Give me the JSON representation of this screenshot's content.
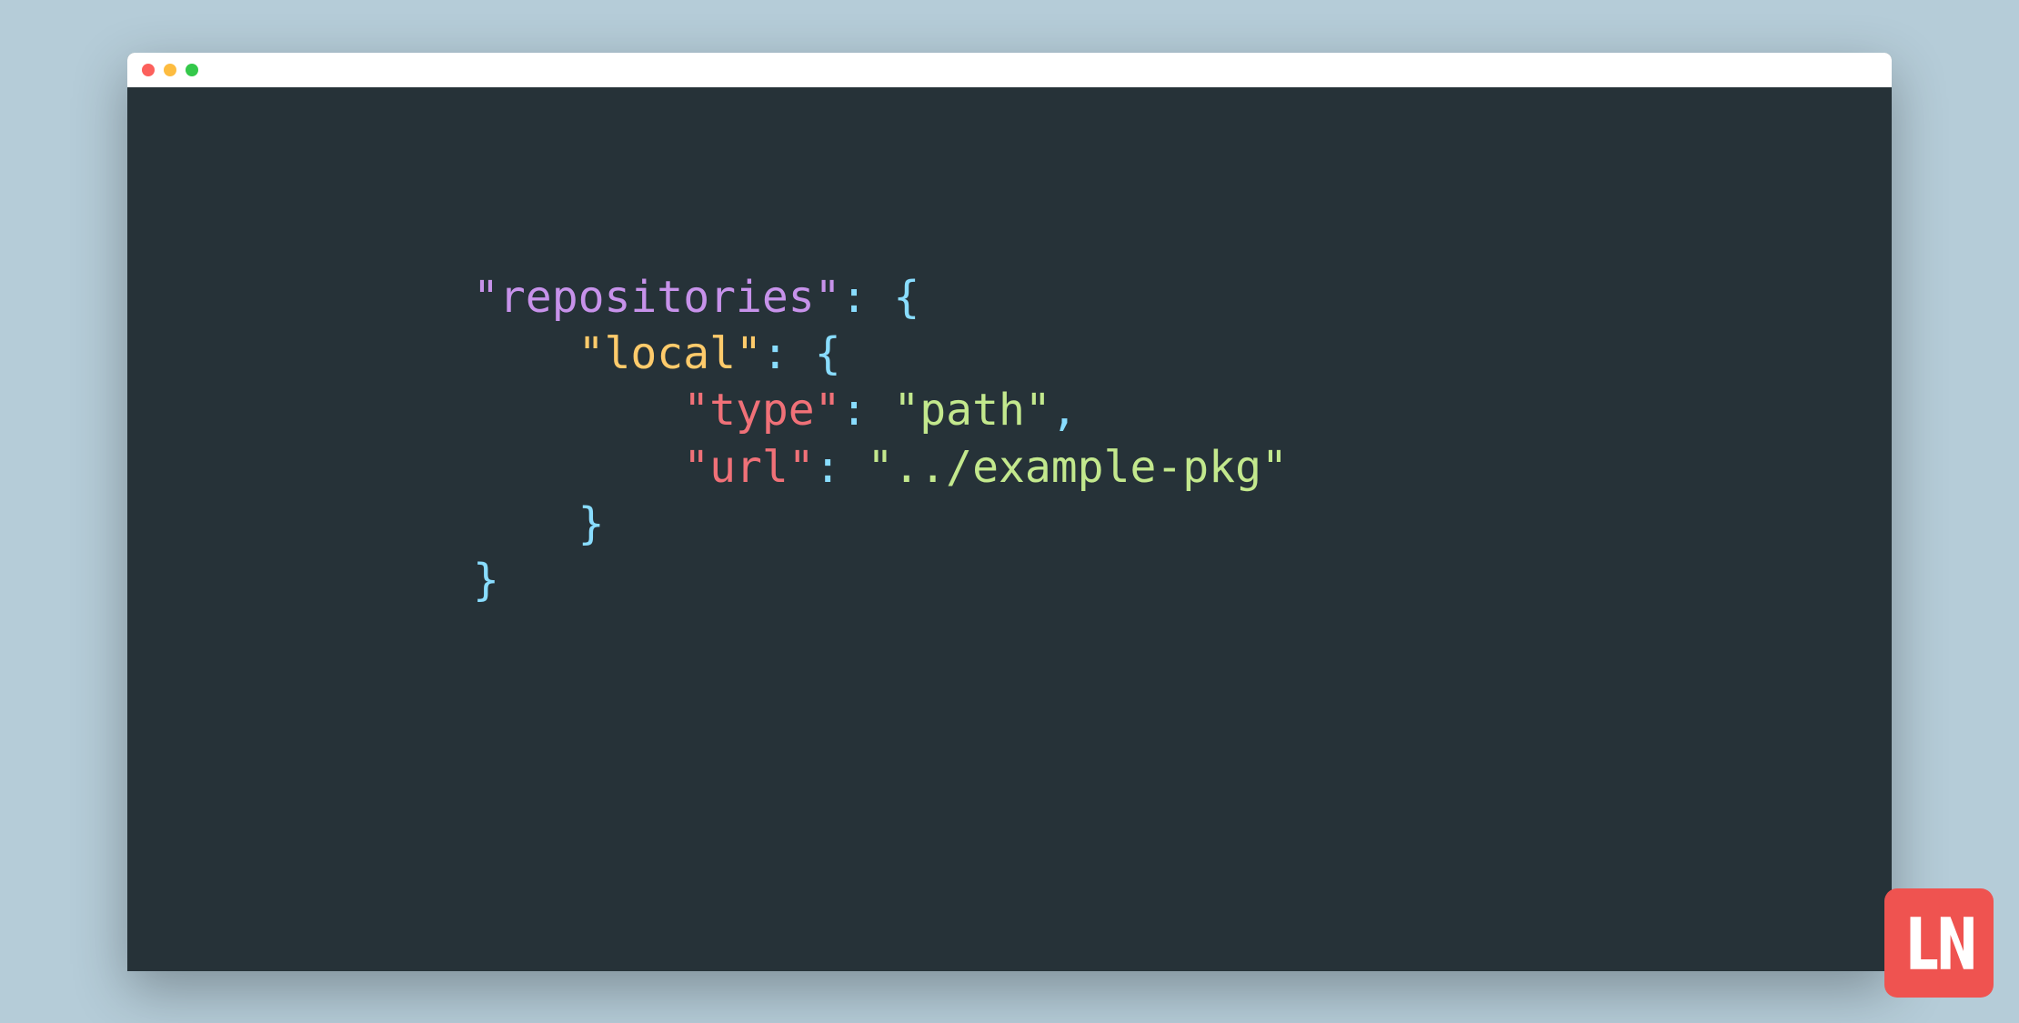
{
  "window": {
    "traffic_lights": {
      "close": "close",
      "minimize": "minimize",
      "zoom": "zoom"
    }
  },
  "code": {
    "line1": {
      "key": "\"repositories\"",
      "colon": ": ",
      "brace": "{"
    },
    "line2": {
      "indent": "    ",
      "key": "\"local\"",
      "colon": ": ",
      "brace": "{"
    },
    "line3": {
      "indent": "        ",
      "key": "\"type\"",
      "colon": ": ",
      "value": "\"path\"",
      "comma": ","
    },
    "line4": {
      "indent": "        ",
      "key": "\"url\"",
      "colon": ": ",
      "value": "\"../example-pkg\""
    },
    "line5": {
      "indent": "    ",
      "brace": "}"
    },
    "line6": {
      "brace": "}"
    }
  },
  "logo": {
    "text": "LN"
  },
  "colors": {
    "background": "#b5ccd8",
    "editor_bg": "#263238",
    "titlebar_bg": "#ffffff",
    "purple": "#c792ea",
    "yellow": "#ffcb6b",
    "orange": "#f07178",
    "cyan": "#89ddff",
    "green": "#c3e88d",
    "badge": "#ef5350"
  }
}
